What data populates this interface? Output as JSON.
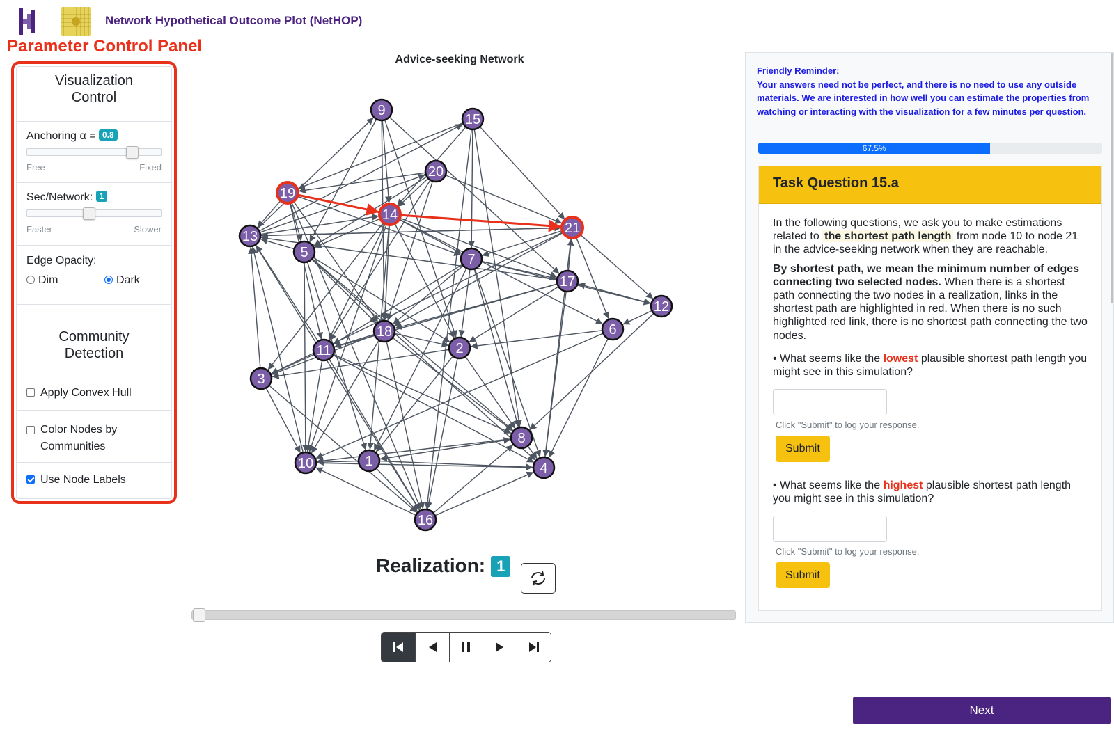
{
  "header": {
    "title": "Network Hypothetical Outcome Plot (NetHOP)",
    "annotation_label": "Parameter Control Panel"
  },
  "control_panel": {
    "viz_heading": "Visualization Control",
    "anchoring": {
      "label": "Anchoring α =",
      "value": "0.8",
      "min_label": "Free",
      "max_label": "Fixed",
      "fraction": 0.8
    },
    "sec_network": {
      "label": "Sec/Network:",
      "value": "1",
      "min_label": "Faster",
      "max_label": "Slower",
      "fraction": 0.45
    },
    "edge_opacity": {
      "label": "Edge Opacity:",
      "options": [
        "Dim",
        "Dark"
      ],
      "selected": "Dark"
    },
    "community_heading": "Community Detection",
    "checkboxes": [
      {
        "label": "Apply Convex Hull",
        "checked": false
      },
      {
        "label": "Color Nodes by Communities",
        "checked": false
      },
      {
        "label": "Use Node Labels",
        "checked": true
      }
    ]
  },
  "network": {
    "title": "Advice-seeking Network",
    "nodes": [
      "1",
      "2",
      "3",
      "4",
      "5",
      "6",
      "7",
      "8",
      "9",
      "10",
      "11",
      "12",
      "13",
      "14",
      "15",
      "16",
      "17",
      "18",
      "19",
      "20",
      "21"
    ],
    "highlighted_nodes": [
      "19",
      "14",
      "21"
    ],
    "highlighted_path": [
      [
        "19",
        "14"
      ],
      [
        "14",
        "21"
      ]
    ],
    "colors": {
      "node": "#7b5ea7",
      "edge": "#4d5560",
      "highlight": "#e8301a"
    }
  },
  "playback": {
    "realization_label": "Realization:",
    "realization_value": "1",
    "refresh_icon": "refresh-icon",
    "controls": [
      "first-icon",
      "prev-icon",
      "pause-icon",
      "next-icon",
      "last-icon"
    ]
  },
  "right_panel": {
    "reminder_title": "Friendly Reminder:",
    "reminder_text": "Your answers need not be perfect, and there is no need to use any outside materials. We are interested in how well you can estimate the properties from watching or interacting with the visualization for a few minutes per question.",
    "progress_label": "67.5%",
    "progress_value": 67.5,
    "task_title": "Task Question 15.a",
    "intro_1": "In the following questions, we ask you to make estimations related to",
    "intro_highlight": "the shortest path length",
    "intro_2": "from node 10 to node 21 in the advice-seeking network when they are reachable.",
    "def_bold": "By shortest path, we mean the minimum number of edges connecting two selected nodes.",
    "def_rest": "When there is a shortest path connecting the two nodes in a realization, links in the shortest path are highlighted in red. When there is no such highlighted red link, there is no shortest path connecting the two nodes.",
    "q1_pre": "• What seems like the",
    "q1_word": "lowest",
    "q1_post": "plausible shortest path length you might see in this simulation?",
    "q2_pre": "• What seems like the",
    "q2_word": "highest",
    "q2_post": "plausible shortest path length you might see in this simulation?",
    "hint": "Click \"Submit\" to log your response.",
    "submit_label": "Submit"
  },
  "next_label": "Next"
}
